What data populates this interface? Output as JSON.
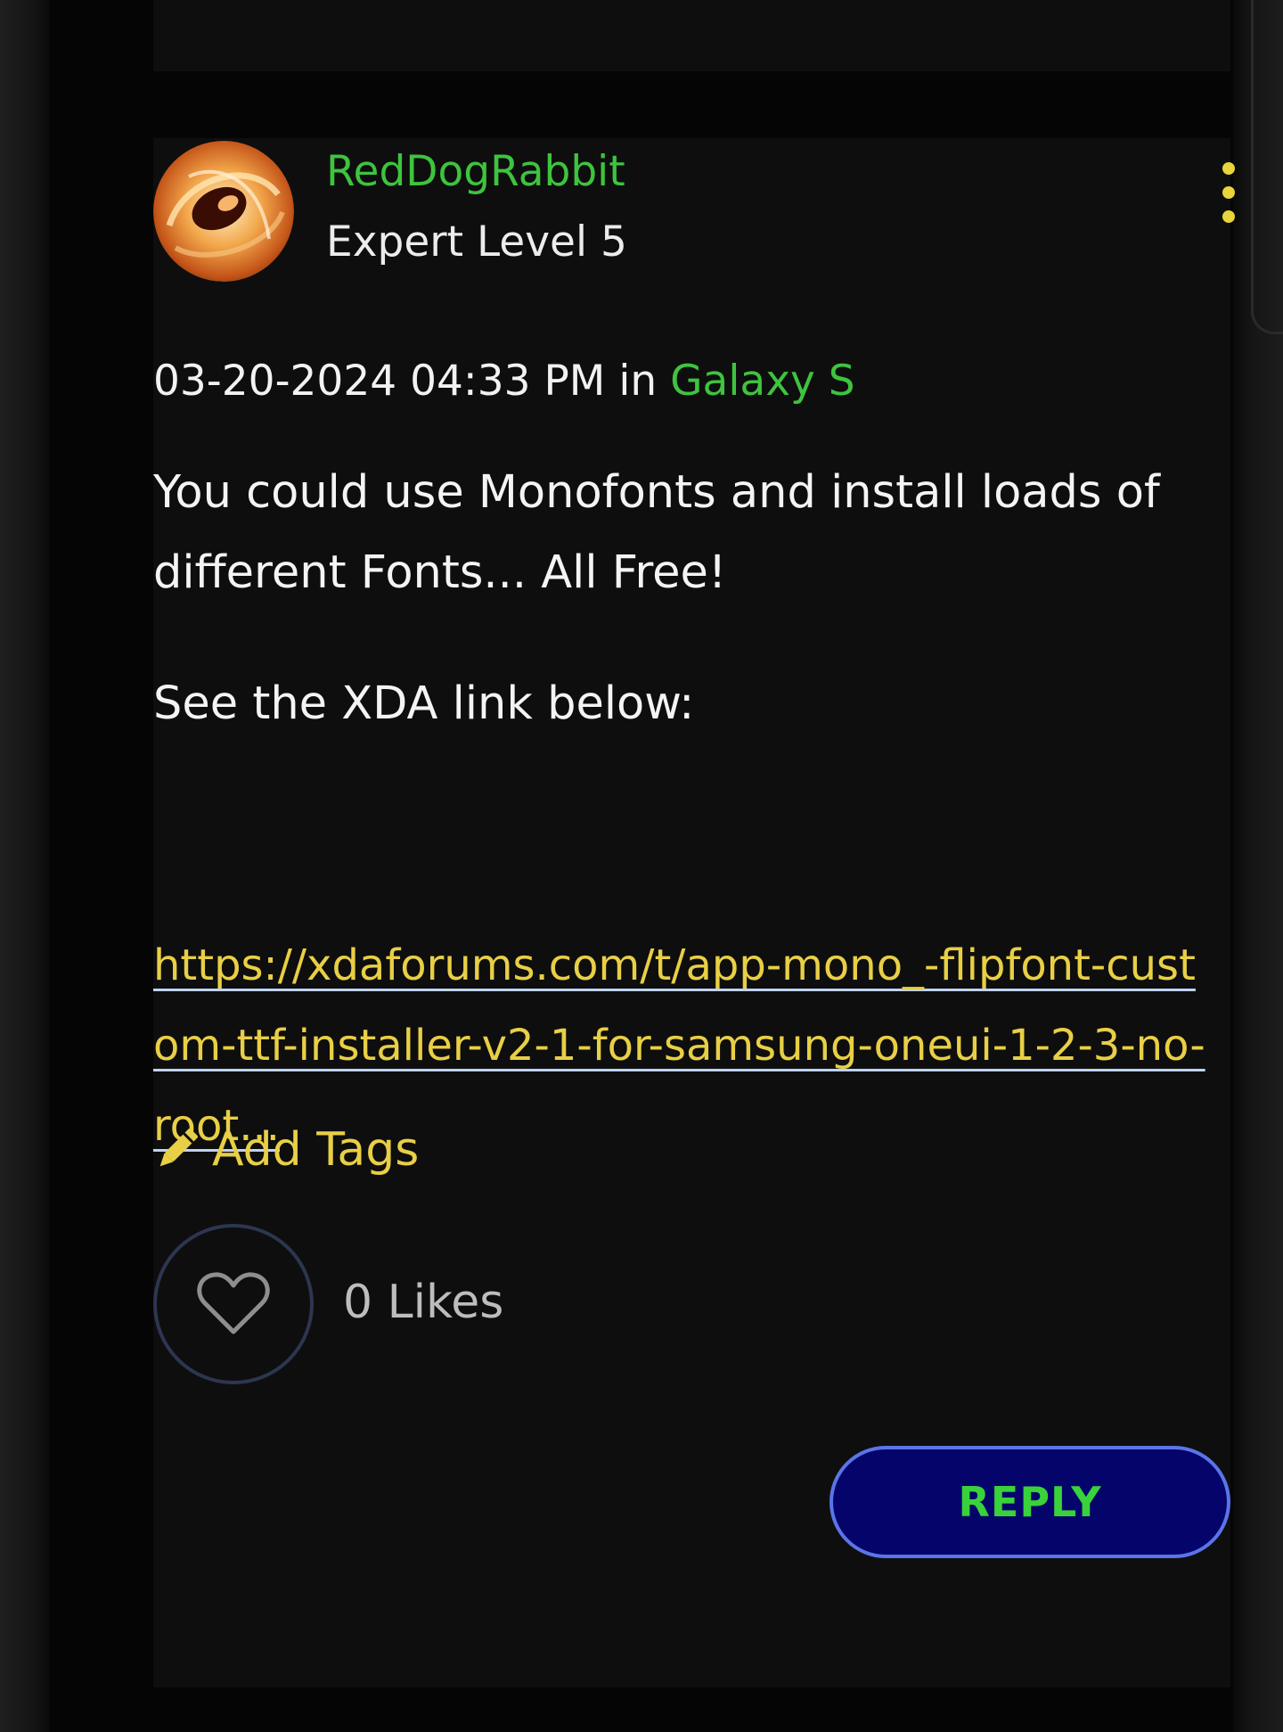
{
  "post": {
    "author": "RedDogRabbit",
    "rank": "Expert Level 5",
    "date": "03-20-2024 04:33 PM",
    "in_word": "in",
    "board": "Galaxy S",
    "body_line1": "You could use Monofonts and install loads of different Fonts... All Free!",
    "body_line2": "See the XDA link below:",
    "link_text": "https://xdaforums.com/t/app-mono_-flipfont-custom-ttf-installer-v2-1-for-samsung-oneui-1-2-3-no-root...",
    "add_tags_label": "Add Tags",
    "likes_label": "0 Likes",
    "reply_label": "REPLY"
  },
  "icons": {
    "options": "kebab-menu-icon",
    "tag": "pencil-icon",
    "like": "heart-icon"
  },
  "colors": {
    "accent_green": "#3ec43e",
    "accent_yellow": "#e8cf45",
    "reply_bg": "#05046b",
    "reply_border": "#5b74e8",
    "card_bg": "#0e0e0e"
  }
}
